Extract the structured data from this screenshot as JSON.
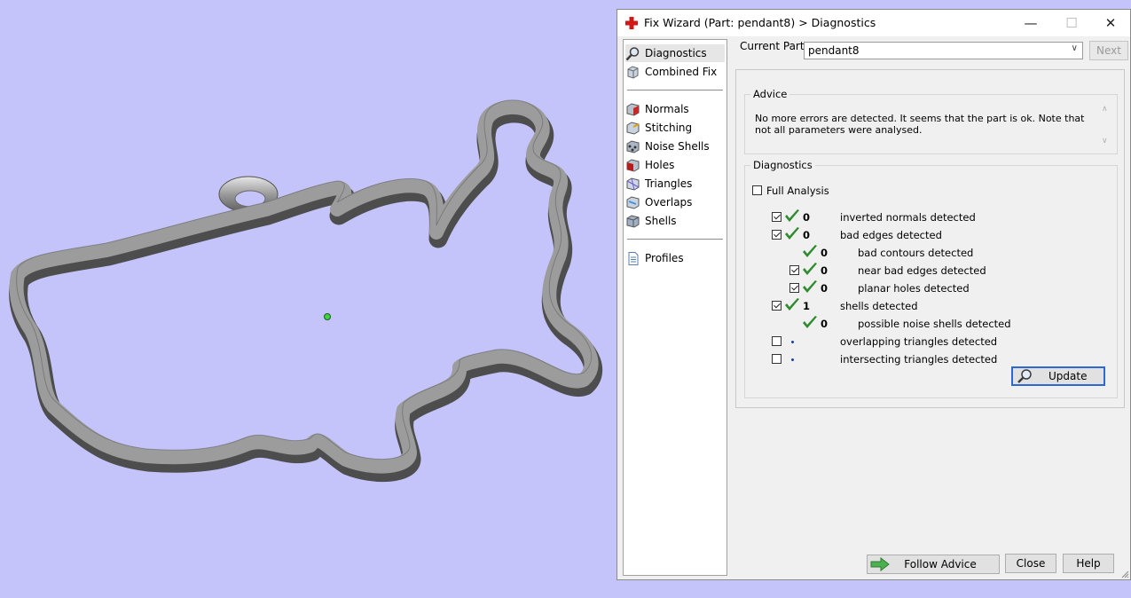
{
  "window": {
    "title": "Fix Wizard (Part: pendant8) > Diagnostics",
    "icon": "red-cross-icon"
  },
  "nav": {
    "top_items": [
      {
        "label": "Diagnostics",
        "icon": "magnifier-icon",
        "selected": true
      },
      {
        "label": "Combined Fix",
        "icon": "cube-icon"
      }
    ],
    "fix_items": [
      {
        "label": "Normals",
        "icon": "normals-cube-icon"
      },
      {
        "label": "Stitching",
        "icon": "stitching-cube-icon"
      },
      {
        "label": "Noise Shells",
        "icon": "noise-shells-icon"
      },
      {
        "label": "Holes",
        "icon": "holes-cube-icon"
      },
      {
        "label": "Triangles",
        "icon": "triangles-cube-icon"
      },
      {
        "label": "Overlaps",
        "icon": "overlaps-cube-icon"
      },
      {
        "label": "Shells",
        "icon": "shells-cube-icon"
      }
    ],
    "profiles": {
      "label": "Profiles",
      "icon": "document-icon"
    }
  },
  "current_part": {
    "label": "Current Part:",
    "value": "pendant8"
  },
  "next_label": "Next",
  "advice": {
    "title": "Advice",
    "text": "No more errors are detected. It seems that the part is ok. Note that not all parameters were analysed."
  },
  "diagnostics": {
    "title": "Diagnostics",
    "full_analysis": {
      "label": "Full Analysis",
      "checked": false
    },
    "rows": [
      {
        "checkbox": true,
        "checked": true,
        "status": "ok",
        "count": "0",
        "label": "inverted normals detected",
        "indent": false
      },
      {
        "checkbox": true,
        "checked": true,
        "status": "ok",
        "count": "0",
        "label": "bad edges detected",
        "indent": false
      },
      {
        "checkbox": false,
        "checked": false,
        "status": "ok",
        "count": "0",
        "label": "bad contours detected",
        "indent": true
      },
      {
        "checkbox": true,
        "checked": true,
        "status": "ok",
        "count": "0",
        "label": "near bad edges detected",
        "indent": true
      },
      {
        "checkbox": true,
        "checked": true,
        "status": "ok",
        "count": "0",
        "label": "planar holes detected",
        "indent": true
      },
      {
        "checkbox": true,
        "checked": true,
        "status": "ok",
        "count": "1",
        "label": "shells detected",
        "indent": false
      },
      {
        "checkbox": false,
        "checked": false,
        "status": "ok",
        "count": "0",
        "label": "possible noise shells detected",
        "indent": true
      },
      {
        "checkbox": true,
        "checked": false,
        "status": "pending",
        "count": "",
        "label": "overlapping triangles detected",
        "indent": false
      },
      {
        "checkbox": true,
        "checked": false,
        "status": "pending",
        "count": "",
        "label": "intersecting triangles detected",
        "indent": false
      }
    ],
    "update_label": "Update"
  },
  "footer": {
    "follow_advice": "Follow Advice",
    "close": "Close",
    "help": "Help"
  },
  "colors": {
    "viewport_bg": "#c4c4fa",
    "model": "#8f8f8f",
    "check_green": "#2e8b2e",
    "accent": "#2a6ad4"
  }
}
